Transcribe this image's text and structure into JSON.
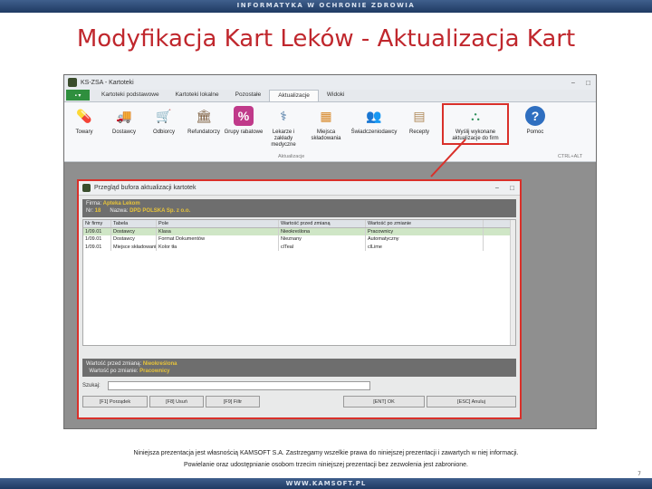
{
  "slide": {
    "header_text": "INFORMATYKA W OCHRONIE ZDROWIA",
    "title": "Modyfikacja Kart Leków - Aktualizacja Kart",
    "footer_line1": "Niniejsza prezentacja jest własnością KAMSOFT S.A. Zastrzegamy wszelkie prawa do niniejszej prezentacji i zawartych w niej informacji.",
    "footer_line2": "Powielanie oraz udostępnianie osobom trzecim niniejszej prezentacji bez zezwolenia jest zabronione.",
    "page_number": "7",
    "bottom_text": "WWW.KAMSOFT.PL"
  },
  "app": {
    "title": "KS-ZSA - Kartoteki",
    "win_controls": [
      "−",
      "□"
    ],
    "file_label": "▪ ▾",
    "tabs": [
      "Kartoteki podstawowe",
      "Kartoteki lokalne",
      "Pozostałe",
      "Aktualizacje",
      "Widoki"
    ],
    "active_tab": "Aktualizacje",
    "ribbon_buttons": [
      {
        "label": "Towary",
        "icon": "pills-icon",
        "glyph": "💊"
      },
      {
        "label": "Dostawcy",
        "icon": "truck-icon",
        "glyph": "🚚"
      },
      {
        "label": "Odbiorcy",
        "icon": "cart-icon",
        "glyph": "🛒"
      },
      {
        "label": "Refundatorzy",
        "icon": "building-icon",
        "glyph": "🏛"
      },
      {
        "label": "Grupy rabatowe",
        "icon": "percent-icon",
        "glyph": "%"
      },
      {
        "label": "Lekarze i zakłady medyczne",
        "icon": "doctor-icon",
        "glyph": "👨‍⚕"
      },
      {
        "label": "Miejsca składowania",
        "icon": "shelf-icon",
        "glyph": "📦"
      },
      {
        "label": "Świadczeniodawcy",
        "icon": "people-icon",
        "glyph": "👥"
      },
      {
        "label": "Recepty",
        "icon": "prescription-icon",
        "glyph": "📄"
      },
      {
        "label": "Wyślij wykonane aktualizacje do firm",
        "icon": "network-icon",
        "glyph": "🖧"
      },
      {
        "label": "Pomoc",
        "icon": "help-icon",
        "glyph": "?"
      }
    ],
    "group_labels": {
      "updates": "Aktualizacje",
      "help": "CTRL+ALT"
    }
  },
  "dialog": {
    "title": "Przegląd bufora aktualizacji kartotek",
    "controls": [
      "−",
      "□"
    ],
    "firma_label": "Firma:",
    "firma_value": "Apteka Lekom",
    "nr_label": "Nr:",
    "nr_value": "18",
    "nazwa_label": "Nazwa:",
    "nazwa_value": "DPD POLSKA Sp. z o.o.",
    "columns": [
      "Nr firmy",
      "Tabela",
      "Pole",
      "Wartość przed zmianą",
      "Wartość po zmianie"
    ],
    "rows": [
      [
        "1/09.01",
        "Dostawcy",
        "Klasa",
        "Nieokreślona",
        "Pracownicy"
      ],
      [
        "1/09.01",
        "Dostawcy",
        "Format Dokumentów",
        "Nieznany",
        "Automatyczny"
      ],
      [
        "1/09.01",
        "Miejsce składowania",
        "Kolor tła",
        "clTeal",
        "clLime"
      ]
    ],
    "before_label": "Wartość przed zmianą:",
    "before_value": "Nieokreślona",
    "after_label": "Wartość po zmianie:",
    "after_value": "Pracownicy",
    "search_label": "Szukaj:",
    "search_value": "",
    "buttons": [
      "[F1] Porządek",
      "[F8] Usuń",
      "[F9] Filtr",
      "[ENT] OK",
      "[ESC] Anuluj"
    ]
  },
  "colors": {
    "title_red": "#c0272d",
    "highlight_red": "#d9302a",
    "selected_row": "#cfe6c6",
    "value_gold": "#e8c43a"
  }
}
